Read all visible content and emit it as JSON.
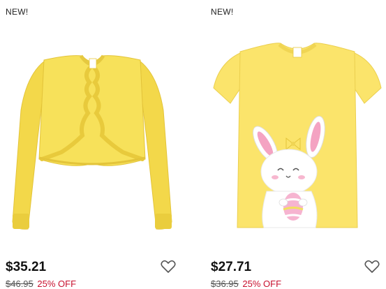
{
  "products": [
    {
      "badge": "NEW!",
      "price": "$35.21",
      "was_price": "$46.95",
      "discount": "25% OFF",
      "image_icon": "yellow-cardigan",
      "wishlist_icon": "heart-outline-icon",
      "colors": {
        "garment": "#f7e15a",
        "discount": "#c8102e"
      }
    },
    {
      "badge": "NEW!",
      "price": "$27.71",
      "was_price": "$36.95",
      "discount": "25% OFF",
      "image_icon": "yellow-bunny-tee",
      "wishlist_icon": "heart-outline-icon",
      "colors": {
        "garment": "#fbe46b",
        "discount": "#c8102e"
      }
    }
  ]
}
